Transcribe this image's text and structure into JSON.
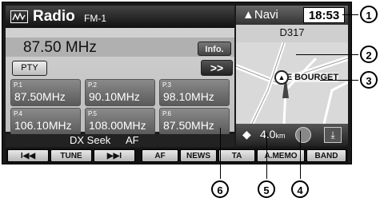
{
  "radio": {
    "title": "Radio",
    "band": "FM-1",
    "frequency": "87.50 MHz",
    "info_label": "Info.",
    "pty_label": "PTY",
    "next_label": ">>",
    "presets": [
      {
        "num": "P.1",
        "freq": "87.50MHz"
      },
      {
        "num": "P.2",
        "freq": "90.10MHz"
      },
      {
        "num": "P.3",
        "freq": "98.10MHz"
      },
      {
        "num": "P.4",
        "freq": "106.10MHz"
      },
      {
        "num": "P.5",
        "freq": "108.00MHz"
      },
      {
        "num": "P.6",
        "freq": "87.50MHz"
      }
    ],
    "seek_mode": "DX Seek",
    "af_status": "AF"
  },
  "softkeys": [
    "I◀◀",
    "TUNE",
    "▶▶I",
    "AF",
    "NEWS",
    "TA",
    "A.MEMO",
    "BAND"
  ],
  "navi": {
    "title": "Navi",
    "clock": "18:53",
    "road": "D317",
    "place": "LE BOURGET",
    "distance": "4.0",
    "distance_unit": "km"
  },
  "callouts": [
    "1",
    "2",
    "3",
    "4",
    "5",
    "6"
  ]
}
